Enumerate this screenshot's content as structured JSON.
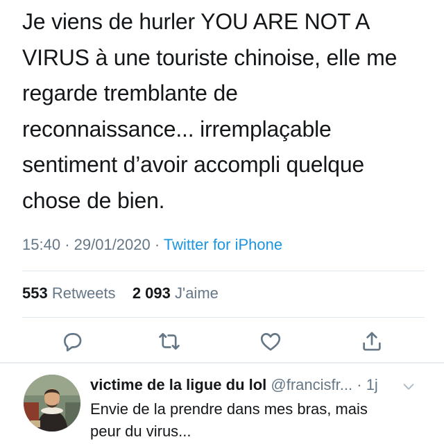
{
  "tweet": {
    "text": "Je viens de hurler YOU ARE NOT A\nVIRUS à une touriste chinoise, elle me\nregarde tremblante de\nreconnaissance... irremplaçable\nsentiment d’avoir accompli quelque\nchose de bien.",
    "time": "15:40",
    "date": "29/01/2020",
    "separator": "·",
    "source": "Twitter for iPhone"
  },
  "stats": {
    "retweets_count": "553",
    "retweets_label": "Retweets",
    "likes_count": "2 093",
    "likes_label": "J'aime"
  },
  "actions": {
    "icons": [
      "reply-icon",
      "retweet-icon",
      "like-icon",
      "share-icon"
    ]
  },
  "reply": {
    "name": "victime de la ligue du lol",
    "handle": "@francisfr...",
    "separator": "·",
    "age": "1j",
    "text": "Envie de la prendre dans mes bras, mais\npeur du virus..."
  },
  "colors": {
    "text": "#14171a",
    "secondary": "#657786",
    "link": "#1b95e0",
    "divider": "#e1e8ed"
  }
}
